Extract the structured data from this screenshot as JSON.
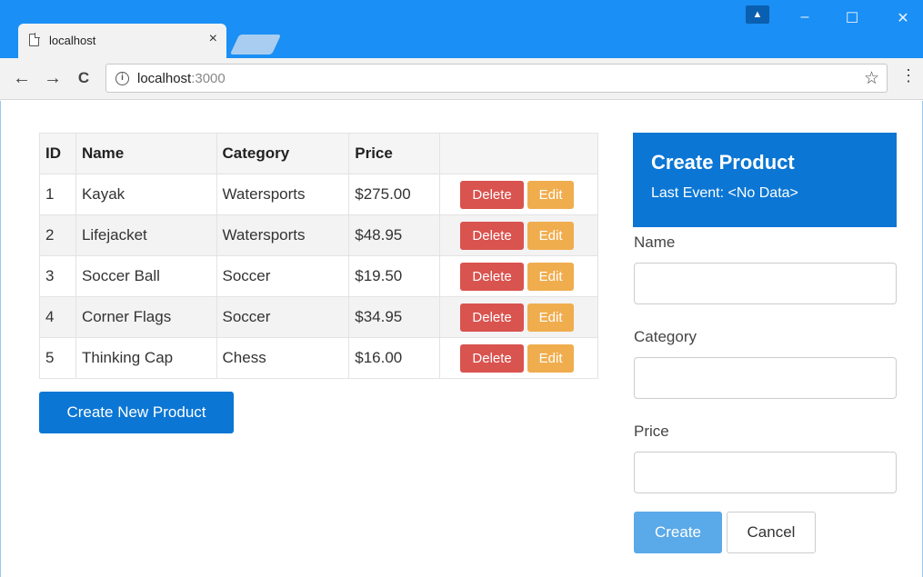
{
  "browser": {
    "tab_title": "localhost",
    "tab_close": "×",
    "url_host": "localhost",
    "url_port": ":3000",
    "icons": {
      "back": "←",
      "forward": "→",
      "reload": "C",
      "info": "i",
      "star": "☆",
      "menu": "⋮",
      "profile": "▲",
      "minimize": "–",
      "maximize": "☐",
      "close": "✕"
    },
    "colors": {
      "titlebar": "#1a8ff5",
      "toolbar": "#f2f2f2"
    }
  },
  "table": {
    "headers": {
      "id": "ID",
      "name": "Name",
      "category": "Category",
      "price": "Price"
    },
    "rows": [
      {
        "id": "1",
        "name": "Kayak",
        "category": "Watersports",
        "price": "$275.00"
      },
      {
        "id": "2",
        "name": "Lifejacket",
        "category": "Watersports",
        "price": "$48.95"
      },
      {
        "id": "3",
        "name": "Soccer Ball",
        "category": "Soccer",
        "price": "$19.50"
      },
      {
        "id": "4",
        "name": "Corner Flags",
        "category": "Soccer",
        "price": "$34.95"
      },
      {
        "id": "5",
        "name": "Thinking Cap",
        "category": "Chess",
        "price": "$16.00"
      }
    ],
    "delete_label": "Delete",
    "edit_label": "Edit"
  },
  "create_new_label": "Create New Product",
  "form": {
    "title": "Create Product",
    "last_event": "Last Event: <No Data>",
    "name_label": "Name",
    "name_value": "",
    "category_label": "Category",
    "category_value": "",
    "price_label": "Price",
    "price_value": "",
    "create_label": "Create",
    "cancel_label": "Cancel"
  },
  "colors": {
    "primary": "#0b76d4",
    "danger": "#d9534f",
    "warning": "#f0ad4e",
    "primary_disabled": "#5aa9e8"
  }
}
